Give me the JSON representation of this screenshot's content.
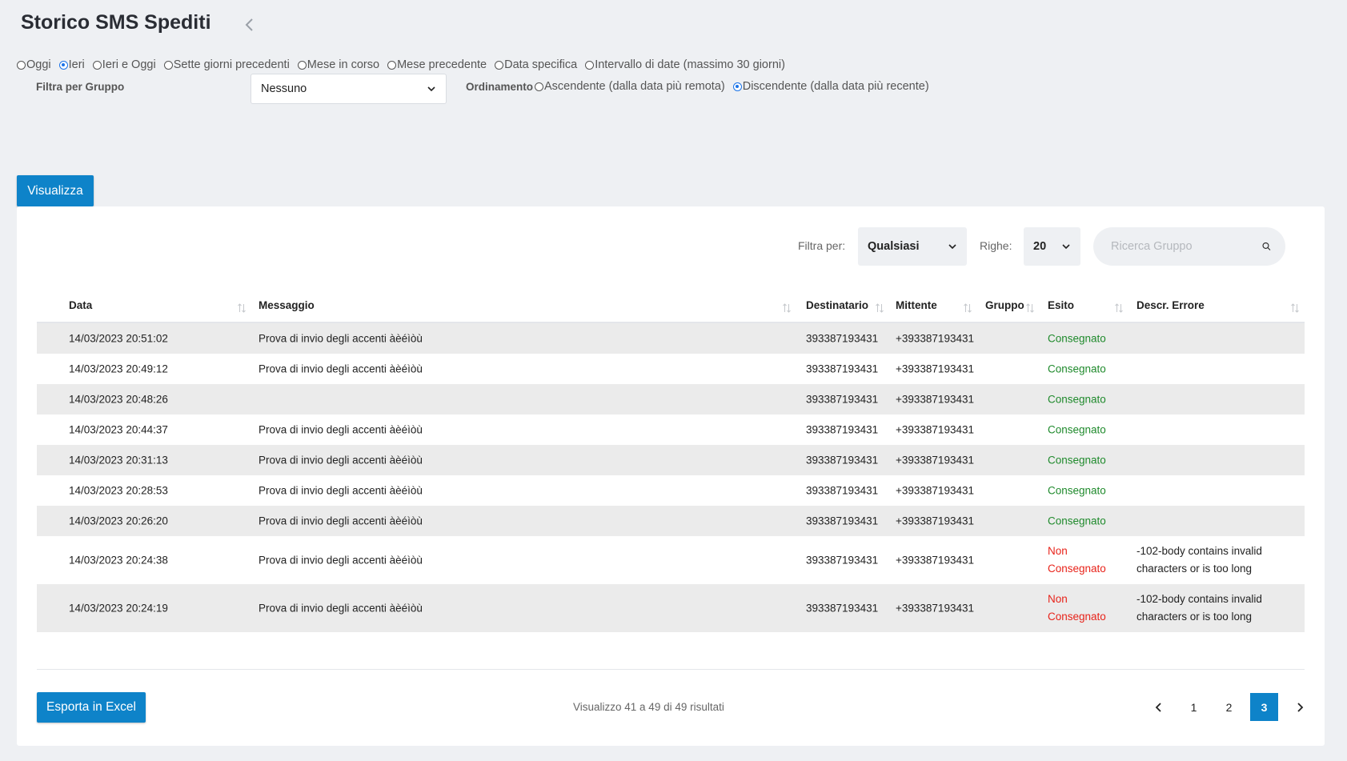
{
  "page": {
    "title": "Storico SMS Spediti"
  },
  "period": {
    "options": [
      "Oggi",
      "Ieri",
      "Ieri e Oggi",
      "Sette giorni precedenti",
      "Mese in corso",
      "Mese precedente",
      "Data specifica",
      "Intervallo di date (massimo 30 giorni)"
    ],
    "selected_index": 1
  },
  "group_filter": {
    "label": "Filtra per Gruppo",
    "value": "Nessuno"
  },
  "ordering": {
    "label": "Ordinamento",
    "options": [
      "Ascendente (dalla data più remota)",
      "Discendente (dalla data più recente)"
    ],
    "selected_index": 1
  },
  "actions": {
    "view_label": "Visualizza",
    "export_label": "Esporta in Excel"
  },
  "table_filters": {
    "filter_label": "Filtra per:",
    "filter_value": "Qualsiasi",
    "rows_label": "Righe:",
    "rows_value": "20",
    "search_placeholder": "Ricerca Gruppo"
  },
  "table": {
    "columns": [
      "Data",
      "Messaggio",
      "Destinatario",
      "Mittente",
      "Gruppo",
      "Esito",
      "Descr. Errore"
    ],
    "rows": [
      {
        "date": "14/03/2023 20:51:02",
        "message": "Prova di invio degli accenti àèéìòù",
        "recipient": "393387193431",
        "sender": "+393387193431",
        "group": "",
        "outcome": "Consegnato",
        "error": ""
      },
      {
        "date": "14/03/2023 20:49:12",
        "message": "Prova di invio degli accenti àèéìòù",
        "recipient": "393387193431",
        "sender": "+393387193431",
        "group": "",
        "outcome": "Consegnato",
        "error": ""
      },
      {
        "date": "14/03/2023 20:48:26",
        "message": "",
        "recipient": "393387193431",
        "sender": "+393387193431",
        "group": "",
        "outcome": "Consegnato",
        "error": ""
      },
      {
        "date": "14/03/2023 20:44:37",
        "message": "Prova di invio degli accenti àèéìòù",
        "recipient": "393387193431",
        "sender": "+393387193431",
        "group": "",
        "outcome": "Consegnato",
        "error": ""
      },
      {
        "date": "14/03/2023 20:31:13",
        "message": "Prova di invio degli accenti àèéìòù",
        "recipient": "393387193431",
        "sender": "+393387193431",
        "group": "",
        "outcome": "Consegnato",
        "error": ""
      },
      {
        "date": "14/03/2023 20:28:53",
        "message": "Prova di invio degli accenti àèéìòù",
        "recipient": "393387193431",
        "sender": "+393387193431",
        "group": "",
        "outcome": "Consegnato",
        "error": ""
      },
      {
        "date": "14/03/2023 20:26:20",
        "message": "Prova di invio degli accenti àèéìòù",
        "recipient": "393387193431",
        "sender": "+393387193431",
        "group": "",
        "outcome": "Consegnato",
        "error": ""
      },
      {
        "date": "14/03/2023 20:24:38",
        "message": "Prova di invio degli accenti àèéìòù",
        "recipient": "393387193431",
        "sender": "+393387193431",
        "group": "",
        "outcome": "Non Consegnato",
        "error": "-102-body contains invalid characters or is too long"
      },
      {
        "date": "14/03/2023 20:24:19",
        "message": "Prova di invio degli accenti àèéìòù",
        "recipient": "393387193431",
        "sender": "+393387193431",
        "group": "",
        "outcome": "Non Consegnato",
        "error": "-102-body contains invalid characters or is too long"
      }
    ]
  },
  "footer": {
    "results_text": "Visualizzo 41 a 49 di 49 risultati"
  },
  "pagination": {
    "pages": [
      "1",
      "2",
      "3"
    ],
    "current": "3"
  },
  "colors": {
    "primary": "#0e83c9",
    "success": "#1f8a2c",
    "error": "#e8231a",
    "radio_selected": "#1a73e8"
  }
}
